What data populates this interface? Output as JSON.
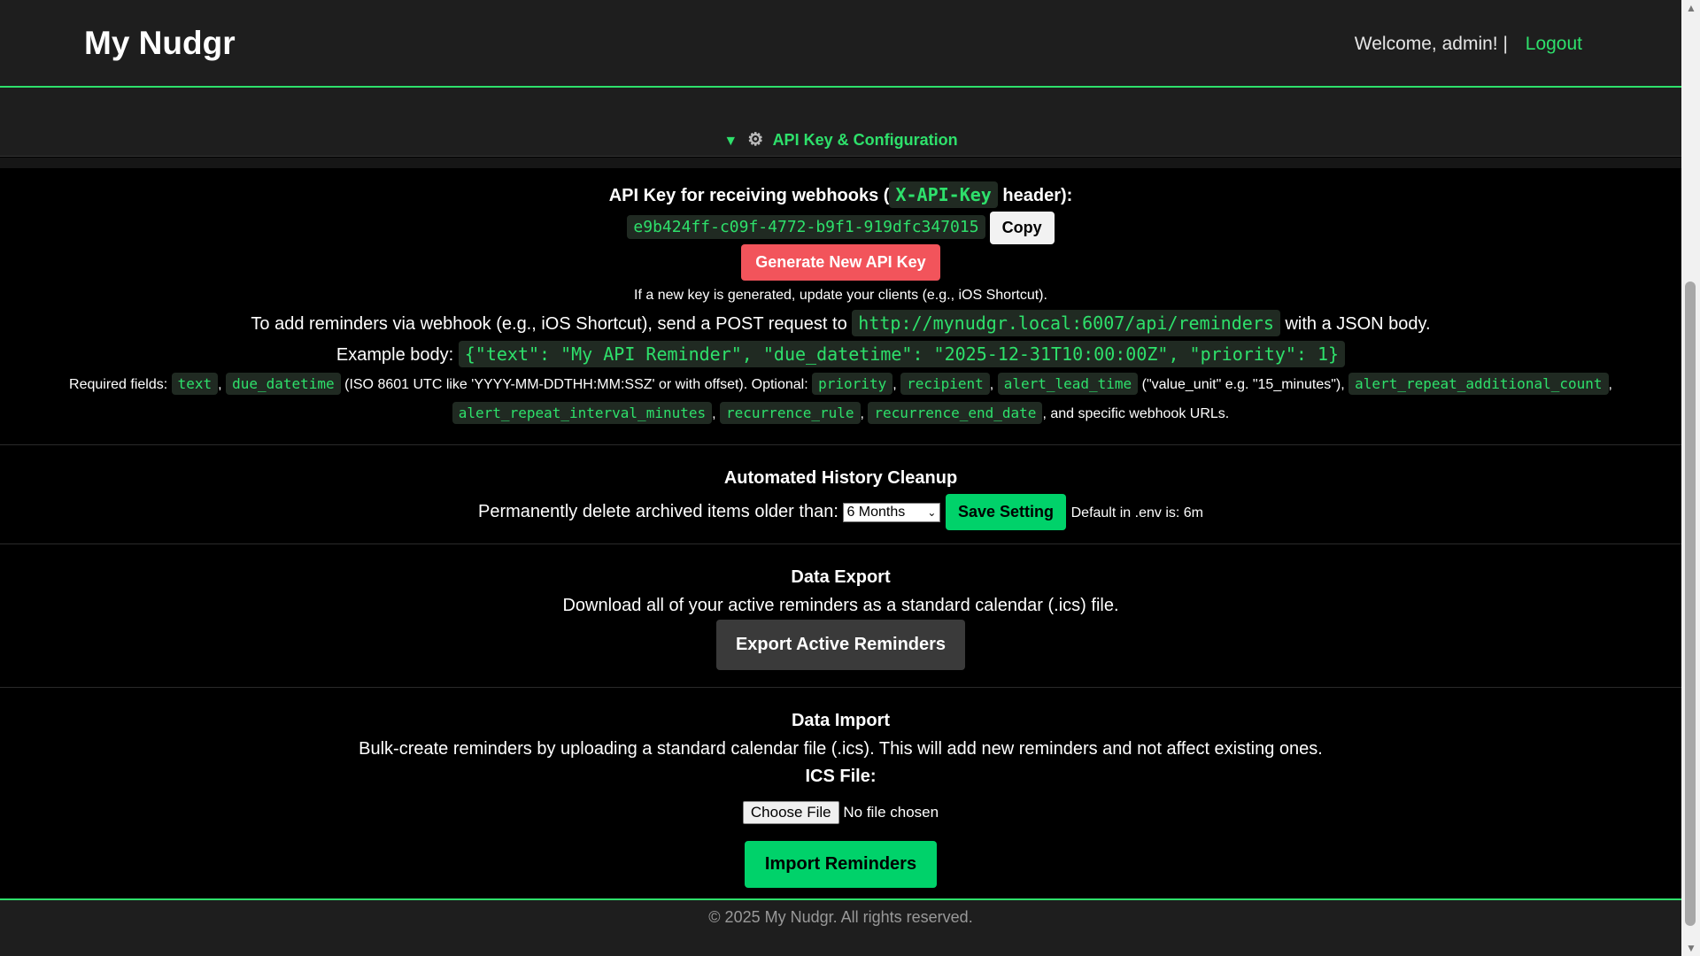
{
  "header": {
    "logo": "My Nudgr",
    "welcome": "Welcome, admin! |",
    "logout": "Logout"
  },
  "config": {
    "summary_toggle": "▼",
    "summary_icon": "gear-icon",
    "summary_label": "API Key & Configuration",
    "api_key_heading_pre": "API Key for receiving webhooks (",
    "api_key_header_name": "X-API-Key",
    "api_key_heading_post": "header):",
    "api_key_value": "e9b424ff-c09f-4772-b9f1-919dfc347015",
    "copy_label": "Copy",
    "generate_label": "Generate New API Key",
    "generate_note": "If a new key is generated, update your clients (e.g., iOS Shortcut).",
    "webhook_pre": "To add reminders via webhook (e.g., iOS Shortcut), send a POST request to",
    "webhook_url": "http://mynudgr.local:6007/api/reminders",
    "webhook_post": "with a JSON body.",
    "example_label": "Example body:",
    "example_body": "{\"text\": \"My API Reminder\", \"due_datetime\": \"2025-12-31T10:00:00Z\", \"priority\": 1}",
    "required_label": "Required fields:",
    "field_text": "text",
    "field_due": "due_datetime",
    "iso_note": "(ISO 8601 UTC like 'YYYY-MM-DDTHH:MM:SSZ' or with offset). Optional:",
    "opt_priority": "priority",
    "opt_recipient": "recipient",
    "opt_lead": "alert_lead_time",
    "lead_note": "(\"value_unit\" e.g. \"15_minutes\"),",
    "opt_repeat_count": "alert_repeat_additional_count",
    "opt_repeat_interval": "alert_repeat_interval_minutes",
    "opt_rule": "recurrence_rule",
    "opt_end": "recurrence_end_date",
    "tail_note": ", and specific webhook URLs."
  },
  "cleanup": {
    "title": "Automated History Cleanup",
    "label": "Permanently delete archived items older than:",
    "selected": "6 Months",
    "save_label": "Save Setting",
    "default_note": "Default in .env is: 6m"
  },
  "export": {
    "title": "Data Export",
    "description": "Download all of your active reminders as a standard calendar (.ics) file.",
    "button": "Export Active Reminders"
  },
  "import": {
    "title": "Data Import",
    "description": "Bulk-create reminders by uploading a standard calendar file (.ics). This will add new reminders and not affect existing ones.",
    "file_label": "ICS File:",
    "choose_file": "Choose File",
    "no_file": "No file chosen",
    "button": "Import Reminders"
  },
  "footer": {
    "text": "© 2025 My Nudgr. All rights reserved."
  },
  "colors": {
    "accent": "#2ee06b",
    "danger": "#f2545b",
    "button_green": "#00d26a",
    "background": "#000000",
    "header_bg": "#1e1e1e"
  }
}
